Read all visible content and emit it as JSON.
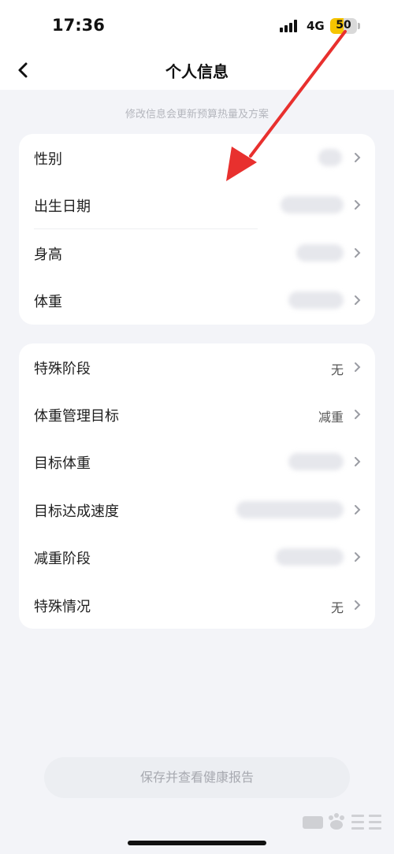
{
  "status_bar": {
    "time": "17:36",
    "network": "4G",
    "battery_level": "50"
  },
  "nav": {
    "title": "个人信息"
  },
  "hint": "修改信息会更新预算热量及方案",
  "basic_card": {
    "rows": [
      {
        "label": "性别",
        "value": ""
      },
      {
        "label": "出生日期",
        "value": ""
      },
      {
        "label": "身高",
        "value": ""
      },
      {
        "label": "体重",
        "value": ""
      }
    ]
  },
  "goal_card": {
    "rows": [
      {
        "label": "特殊阶段",
        "value": "无"
      },
      {
        "label": "体重管理目标",
        "value": "减重"
      },
      {
        "label": "目标体重",
        "value": ""
      },
      {
        "label": "目标达成速度",
        "value": ""
      },
      {
        "label": "减重阶段",
        "value": ""
      },
      {
        "label": "特殊情况",
        "value": "无"
      }
    ]
  },
  "save_button": "保存并查看健康报告",
  "colors": {
    "background": "#f3f4f8",
    "card": "#ffffff",
    "annotation_arrow": "#e8302e",
    "battery": "#f6c400"
  }
}
